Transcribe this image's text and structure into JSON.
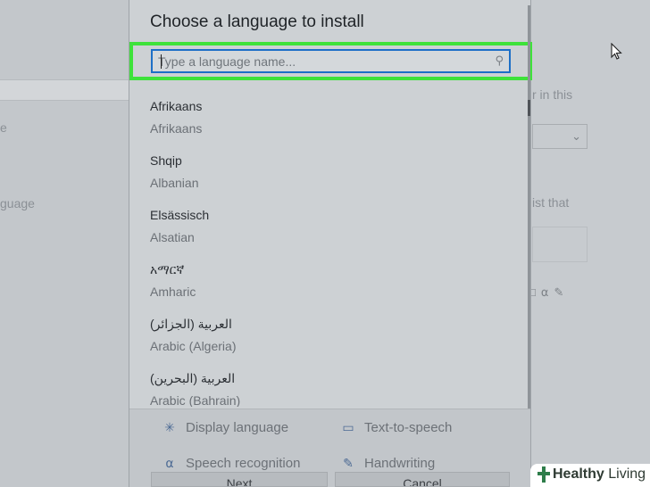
{
  "dialog": {
    "title": "Choose a language to install",
    "search": {
      "placeholder": "Type a language name...",
      "value": ""
    },
    "languages": [
      {
        "native": "Afrikaans",
        "english": "Afrikaans"
      },
      {
        "native": "Shqip",
        "english": "Albanian"
      },
      {
        "native": "Elsässisch",
        "english": "Alsatian"
      },
      {
        "native": "አማርኛ",
        "english": "Amharic"
      },
      {
        "native": "العربية (الجزائر)",
        "english": "Arabic (Algeria)"
      },
      {
        "native": "العربية (البحرين)",
        "english": "Arabic (Bahrain)"
      }
    ],
    "features": {
      "display_language": "Display language",
      "text_to_speech": "Text-to-speech",
      "speech_recognition": "Speech recognition",
      "handwriting": "Handwriting"
    },
    "buttons": {
      "next": "Next",
      "cancel": "Cancel"
    }
  },
  "background": {
    "left_text_1": "e",
    "left_text_2": "guage",
    "right_text_1": "r in this",
    "right_text_2": "ist that"
  },
  "watermark": {
    "bold": "Healthy",
    "light": "Living"
  },
  "colors": {
    "highlight": "#3ee23a",
    "focus_border": "#1d6fc7",
    "brand": "#2e7d4a"
  }
}
